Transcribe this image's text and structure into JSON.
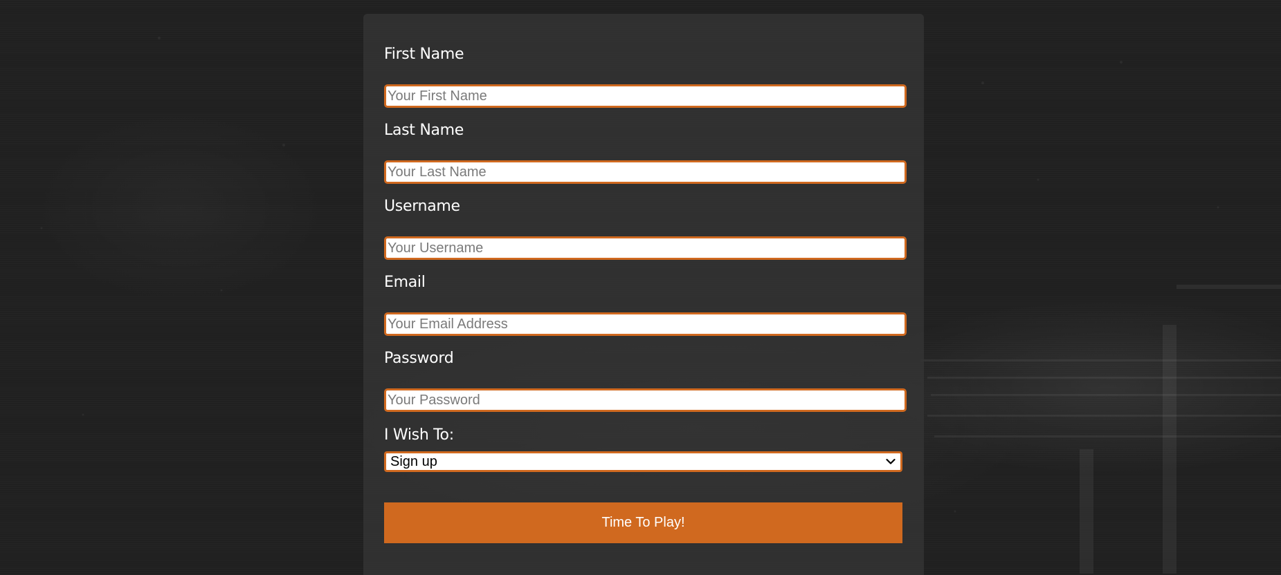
{
  "colors": {
    "background": "#202020",
    "panel": "#343434",
    "accent": "#d0691f",
    "label_text": "#ffffff",
    "placeholder_text": "#7a7a7a"
  },
  "form": {
    "first_name": {
      "label": "First Name",
      "placeholder": "Your First Name",
      "value": ""
    },
    "last_name": {
      "label": "Last Name",
      "placeholder": "Your Last Name",
      "value": ""
    },
    "username": {
      "label": "Username",
      "placeholder": "Your Username",
      "value": ""
    },
    "email": {
      "label": "Email",
      "placeholder": "Your Email Address",
      "value": ""
    },
    "password": {
      "label": "Password",
      "placeholder": "Your Password",
      "value": ""
    },
    "intent": {
      "label": "I Wish To:",
      "selected": "Sign up",
      "icon": "chevron-down-icon"
    },
    "submit_label": "Time To Play!"
  }
}
